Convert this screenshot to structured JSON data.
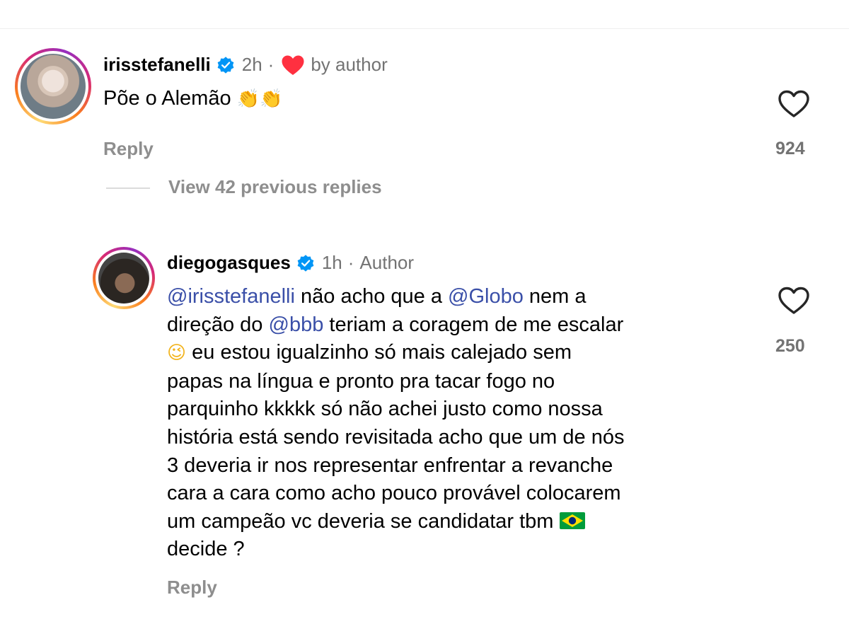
{
  "comment1": {
    "username": "irisstefanelli",
    "time": "2h",
    "liked_by": "by author",
    "text": "Põe o Alemão",
    "emojis": "👏👏",
    "reply_label": "Reply",
    "likes": "924",
    "avatar_icon": "profile-photo"
  },
  "thread": {
    "view_replies_label": "View 42 previous replies"
  },
  "comment2": {
    "username": "diegogasques",
    "time": "1h",
    "author_label": "Author",
    "mentions": [
      "@irisstefanelli",
      "@Globo",
      "@bbb"
    ],
    "text_1": " não acho que a ",
    "text_2": " nem a",
    "text_3": "direção do ",
    "text_4": " teriam a coragem de me escalar",
    "emoji_wink": "😉",
    "text_5": "  eu estou igualzinho só mais calejado sem",
    "text_6": "papas na língua e pronto pra tacar fogo no",
    "text_7": "parquinho kkkkk só não achei justo como nossa",
    "text_8": "história está sendo revisitada acho que um de nós",
    "text_9": "3 deveria ir nos representar enfrentar a revanche",
    "text_10": "cara a cara como acho pouco provável colocarem",
    "text_11": "um campeão vc deveria se candidatar tbm ",
    "text_12": "decide ?",
    "flag_icon": "brazil-flag",
    "reply_label": "Reply",
    "likes": "250"
  },
  "colors": {
    "mention": "#3a4fa8",
    "verified": "#0095f6",
    "heart_red": "#ff3040",
    "muted": "#737373"
  }
}
